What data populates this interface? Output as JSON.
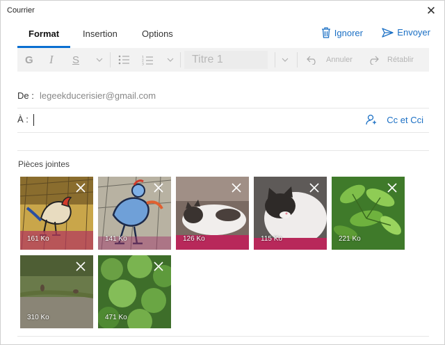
{
  "window": {
    "title": "Courrier"
  },
  "tabs": [
    {
      "label": "Format"
    },
    {
      "label": "Insertion"
    },
    {
      "label": "Options"
    }
  ],
  "actions": {
    "discard": "Ignorer",
    "send": "Envoyer"
  },
  "toolbar": {
    "bold": "G",
    "italic": "I",
    "underline": "S",
    "style": "Titre 1",
    "undo": "Annuler",
    "redo": "Rétablir"
  },
  "from": {
    "label": "De :",
    "value": "legeekducerisier@gmail.com"
  },
  "to": {
    "label": "À :",
    "cc_label": "Cc et Cci"
  },
  "attachments": {
    "title": "Pièces jointes",
    "items": [
      {
        "size": "161 Ko"
      },
      {
        "size": "141 Ko"
      },
      {
        "size": "126 Ko"
      },
      {
        "size": "115 Ko"
      },
      {
        "size": "221 Ko"
      },
      {
        "size": "310 Ko"
      },
      {
        "size": "471 Ko"
      }
    ]
  },
  "colors": {
    "accent": "#1a6fc4",
    "tab_underline": "#0a6fd1",
    "toolbar_bg": "#f2f2f2"
  }
}
